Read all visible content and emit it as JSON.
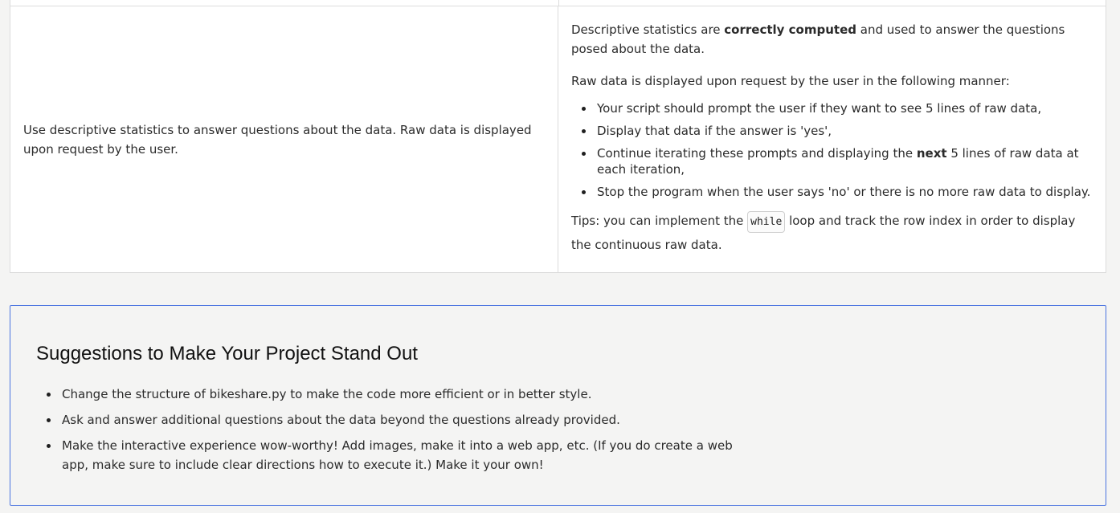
{
  "criteria": {
    "spec_text": "Use descriptive statistics to answer questions about the data. Raw data is displayed upon request by the user.",
    "p1_pre": "Descriptive statistics are ",
    "p1_bold": "correctly computed",
    "p1_post": " and used to answer the questions posed about the data.",
    "p2": "Raw data is displayed upon request by the user in the following manner:",
    "items": {
      "0": "Your script should prompt the user if they want to see 5 lines of raw data,",
      "1": "Display that data if the answer is 'yes',",
      "2_pre": "Continue iterating these prompts and displaying the ",
      "2_bold": "next",
      "2_post": " 5 lines of raw data at each iteration,",
      "3": "Stop the program when the user says 'no' or there is no more raw data to display."
    },
    "tips_pre": "Tips: you can implement the ",
    "tips_code": "while",
    "tips_post": " loop and track the row index in order to display the continuous raw data."
  },
  "suggestions": {
    "title": "Suggestions to Make Your Project Stand Out",
    "items": [
      "Change the structure of bikeshare.py to make the code more efficient or in better style.",
      "Ask and answer additional questions about the data beyond the questions already provided.",
      "Make the interactive experience wow-worthy! Add images, make it into a web app, etc. (If you do create a web app, make sure to include clear directions how to execute it.) Make it your own!"
    ]
  }
}
